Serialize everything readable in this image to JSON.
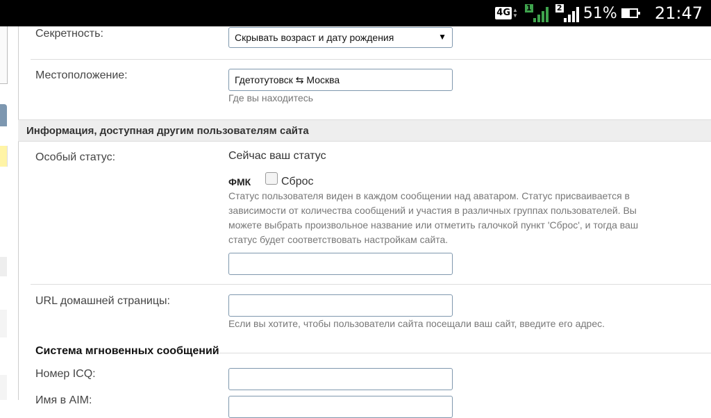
{
  "statusbar": {
    "network": "4G",
    "sim1": "1",
    "sim2": "2",
    "battery_percent": "51%",
    "battery_level": 0.51,
    "time": "21:47"
  },
  "form": {
    "privacy": {
      "label": "Секретность:",
      "value": "Скрывать возраст и дату рождения"
    },
    "location": {
      "label": "Местоположение:",
      "value": "Гдетотутовск ⇆ Москва",
      "hint": "Где вы находитесь"
    },
    "section_title": "Информация, доступная другим пользователям сайта",
    "special_status": {
      "label": "Особый статус:",
      "current_text": "Сейчас ваш статус",
      "current_value": "ФМК",
      "reset_label": "Сброс",
      "hint": "Статус пользователя виден в каждом сообщении над аватаром. Статус присваивается в зависимости от количества сообщений и участия в различных группах пользователей. Вы можете выбрать произвольное название или отметить галочкой пункт 'Сброс', и тогда ваш статус будет соответствовать настройкам сайта.",
      "input_value": ""
    },
    "homepage": {
      "label": "URL домашней страницы:",
      "value": "",
      "hint": "Если вы хотите, чтобы пользователи сайта посещали ваш сайт, введите его адрес."
    },
    "im_section_title": "Система мгновенных сообщений",
    "icq": {
      "label": "Номер ICQ:",
      "value": ""
    },
    "aim": {
      "label": "Имя в AIM:",
      "value": ""
    }
  }
}
